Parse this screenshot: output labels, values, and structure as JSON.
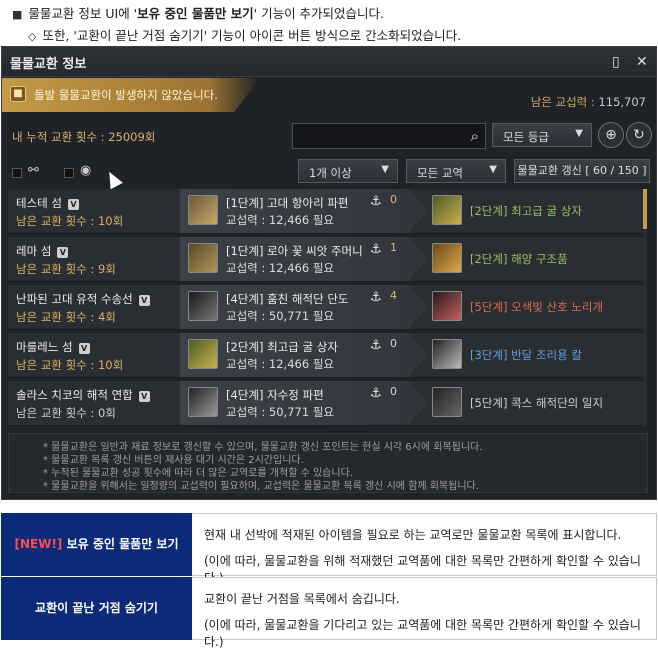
{
  "notes": {
    "line1_pre": "물물교환 정보 UI에 '",
    "line1_bold": "보유 중인 물품만 보기",
    "line1_post": "' 기능이 추가되었습니다.",
    "line2": "또한, '교환이 끝난 거점 숨기기' 기능이 아이콘 버튼 방식으로 간소화되었습니다."
  },
  "window": {
    "title": "물물교환 정보",
    "banner_text": "돌발 물물교환이 발생하지 않았습니다.",
    "remaining_label": "남은 교섭력 :",
    "remaining_value": "115,707",
    "accum_label": "내 누적 교환 횟수 : 25009회",
    "search_placeholder": "",
    "grade_dropdown": "모든 등급",
    "count_dropdown": "1개 이상",
    "trade_dropdown": "모든 교역",
    "refresh_button": "물물교환 갱신 [ 60 / 150 ]"
  },
  "rows": [
    {
      "loc": "테스테 섬",
      "cnt": "남은 교환 횟수 : 10회",
      "in_name": "[1단계] 고대 항아리 파편",
      "in_req": "교섭력 : 12,466 필요",
      "anchor": "0",
      "out_name": "[2단계] 최고급 굴 상자",
      "out_color": "g"
    },
    {
      "loc": "레마 섬",
      "cnt": "남은 교환 횟수 : 9회",
      "in_name": "[1단계] 로아 꽃 씨앗 주머니",
      "in_req": "교섭력 : 12,466 필요",
      "anchor": "1",
      "out_name": "[2단계] 해양 구조품",
      "out_color": "g"
    },
    {
      "loc": "난파된 고대 유적 수송선",
      "cnt": "남은 교환 횟수 : 4회",
      "in_name": "[4단계] 훔친 해적단 단도",
      "in_req": "교섭력 : 50,771 필요",
      "anchor": "4",
      "out_name": "[5단계] 오색빛 산호 노리개",
      "out_color": "r"
    },
    {
      "loc": "마를레느 섬",
      "cnt": "남은 교환 횟수 : 10회",
      "in_name": "[2단계] 최고급 굴 상자",
      "in_req": "교섭력 : 12,466 필요",
      "anchor": "0",
      "out_name": "[3단계] 반달 조리용 칼",
      "out_color": "bl"
    },
    {
      "loc": "솔라스 치코의 해적 연합",
      "cnt": "남은 교환 횟수 : 0회",
      "in_name": "[4단계] 자수정 파편",
      "in_req": "교섭력 : 50,771 필요",
      "anchor": "0",
      "out_name": "[5단계] 콕스 해적단의 일지",
      "out_color": "w"
    }
  ],
  "footnotes": [
    "* 물물교환은 일반과 재료 정보로 갱신할 수 있으며, 물물교환 갱신 포인트는 현실 시각 6시에 회복됩니다.",
    "* 물물교환 목록 갱신 버튼의 재사용 대기 시간은 2시간입니다.",
    "* 누적된 물물교환 성공 횟수에 따라 더 많은 교역로를 개척할 수 있습니다.",
    "* 물물교환을 위해서는 일정량의 교섭력이 필요하며, 교섭력은 물물교환 목록 갱신 시에 함께 회복됩니다."
  ],
  "table": [
    {
      "head_new": "[NEW!]",
      "head": " 보유 중인 물품만 보기",
      "l1": "현재 내 선박에 적재된 아이템을 필요로 하는 교역로만 물물교환 목록에 표시합니다.",
      "l2": "(이에 따라, 물물교환을 위해 적재했던 교역품에 대한 목록만 간편하게 확인할 수 있습니다.)"
    },
    {
      "head_new": "",
      "head": "교환이 끝난 거점 숨기기",
      "l1": "교환이 끝난 거점을 목록에서 숨깁니다.",
      "l2": "(이에 따라, 물물교환을 기다리고 있는 교역품에 대한 목록만 간편하게 확인할 수 있습니다.)"
    }
  ],
  "colors": {
    "accent_gold": "#d8b469",
    "header_blue": "#0b2a78",
    "new_red": "#ff4d4d"
  },
  "icons": [
    "page-icon",
    "close-icon",
    "search-icon",
    "target-icon",
    "refresh-icon",
    "anchor-icon"
  ]
}
